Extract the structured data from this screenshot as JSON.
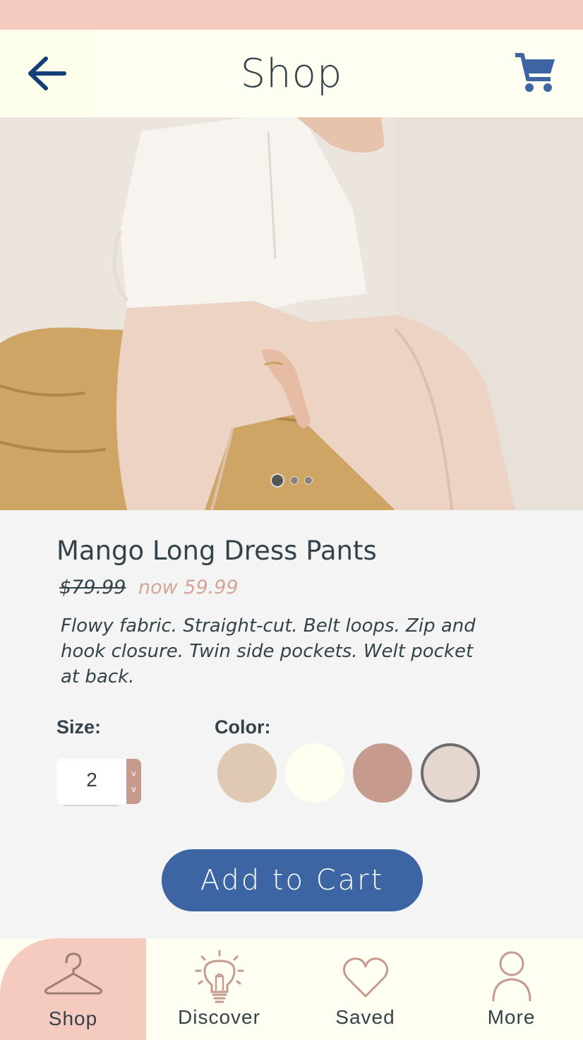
{
  "header": {
    "title": "Shop",
    "back_icon": "arrow-left-icon",
    "cart_icon": "shopping-cart-icon"
  },
  "carousel": {
    "image_count": 3,
    "active_index": 0
  },
  "product": {
    "name": "Mango Long Dress Pants",
    "old_price": "$79.99",
    "new_price": "now 59.99",
    "description": "Flowy fabric. Straight-cut. Belt loops. Zip and hook closure. Twin side pockets. Welt pocket at back."
  },
  "options": {
    "size_label": "Size:",
    "size_value": "2",
    "stepper_up": "v",
    "stepper_down": "v",
    "color_label": "Color:",
    "colors": [
      "#dfc9b3",
      "#fffff0",
      "#c69b8d",
      "#e5d6cf"
    ],
    "selected_color_index": 3
  },
  "actions": {
    "add_to_cart": "Add to Cart"
  },
  "tabs": [
    {
      "label": "Shop",
      "icon": "hanger-icon",
      "active": true
    },
    {
      "label": "Discover",
      "icon": "lightbulb-icon",
      "active": false
    },
    {
      "label": "Saved",
      "icon": "heart-icon",
      "active": false
    },
    {
      "label": "More",
      "icon": "user-icon",
      "active": false
    }
  ],
  "colors": {
    "accent": "#3d65a3",
    "status_bar": "#f6cbbf",
    "header_bg": "#fefef2",
    "text": "#34424a",
    "sale_price": "#d2a597",
    "icon_stroke": "#c69b8d"
  }
}
